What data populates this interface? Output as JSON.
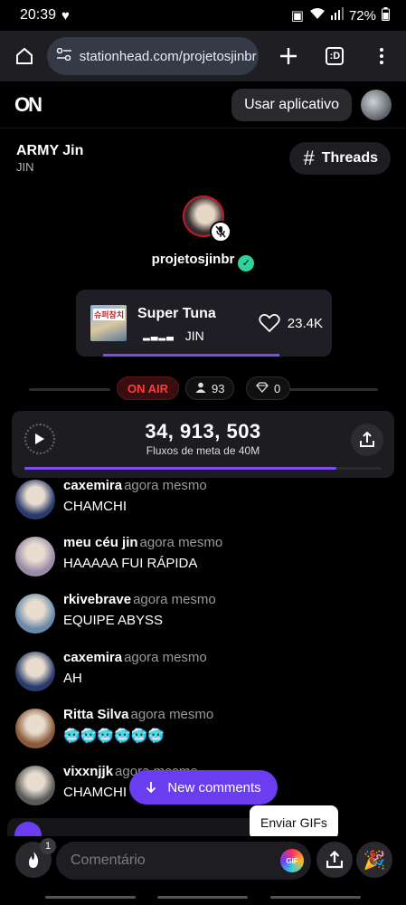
{
  "status_bar": {
    "time": "20:39",
    "battery": "72%"
  },
  "browser": {
    "url": "stationhead.com/projetosjinbr",
    "tab_count": ":D"
  },
  "app_header": {
    "logo": "ON",
    "open_app_label": "Usar aplicativo"
  },
  "station": {
    "title": "ARMY Jin",
    "subtitle": "JIN",
    "threads_label": "Threads"
  },
  "host": {
    "username": "projetosjinbr"
  },
  "now_playing": {
    "album_art_text": "슈퍼참치",
    "title": "Super Tuna",
    "artist": "JIN",
    "likes": "23.4K",
    "progress": 0.69
  },
  "live": {
    "status": "ON AIR",
    "listeners": "93",
    "diamonds": "0"
  },
  "stream_goal": {
    "count": "34, 913, 503",
    "caption": "Fluxos de meta de 40M",
    "progress": 0.873
  },
  "comments": [
    {
      "user": "caxemira",
      "time": "agora mesmo",
      "text": "CHAMCHI",
      "avatar_color": "#2a3a6a"
    },
    {
      "user": "meu céu jin",
      "time": "agora mesmo",
      "text": "HAAAAA FUI RÁPIDA",
      "avatar_color": "#9a8aa8"
    },
    {
      "user": "rkivebrave",
      "time": "agora mesmo",
      "text": "EQUIPE ABYSS",
      "avatar_color": "#6a8aa8"
    },
    {
      "user": "caxemira",
      "time": "agora mesmo",
      "text": "AH",
      "avatar_color": "#2a3a6a"
    },
    {
      "user": "Ritta Silva",
      "time": "agora mesmo",
      "text": "🥶🥶🥶🥶🥶🥶",
      "avatar_color": "#8a5a3a"
    },
    {
      "user": "vixxnjjk",
      "time": "agora mesmo",
      "text": "CHAMCHI",
      "avatar_color": "#5a5a5a"
    }
  ],
  "new_comments_label": "New comments",
  "gif_tooltip": "Enviar GIFs",
  "composer": {
    "placeholder": "Comentário",
    "fire_count": "1",
    "gif_label": "GIF"
  },
  "colors": {
    "accent": "#7d4cf4",
    "on_air": "#ff3b3b",
    "verified": "#2fd39c"
  }
}
